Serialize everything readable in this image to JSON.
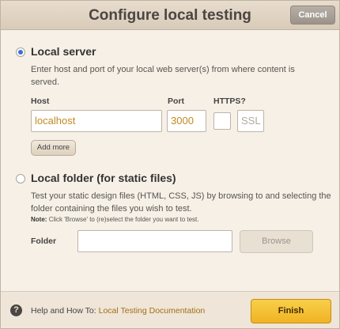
{
  "header": {
    "title": "Configure local testing",
    "cancel_label": "Cancel"
  },
  "local_server": {
    "title": "Local server",
    "selected": true,
    "description": "Enter host and port of your local web server(s) from where content is served.",
    "host_label": "Host",
    "host_value": "localhost",
    "port_label": "Port",
    "port_value": "3000",
    "https_label": "HTTPS?",
    "ssl_placeholder": "SSL",
    "add_more_label": "Add more"
  },
  "local_folder": {
    "title": "Local folder (for static files)",
    "selected": false,
    "description": "Test your static design files (HTML, CSS, JS) by browsing to and selecting the folder containing the files you wish to test.",
    "note_prefix": "Note:",
    "note_text": "Click 'Browse' to (re)select the folder you want to test.",
    "folder_label": "Folder",
    "folder_value": "",
    "browse_label": "Browse"
  },
  "footer": {
    "help_icon": "question-icon",
    "help_prefix": "Help and How To: ",
    "help_link": "Local Testing Documentation",
    "finish_label": "Finish"
  },
  "colors": {
    "accent": "#f3bb2d",
    "link": "#a26f14",
    "radio": "#3b6fd6"
  }
}
